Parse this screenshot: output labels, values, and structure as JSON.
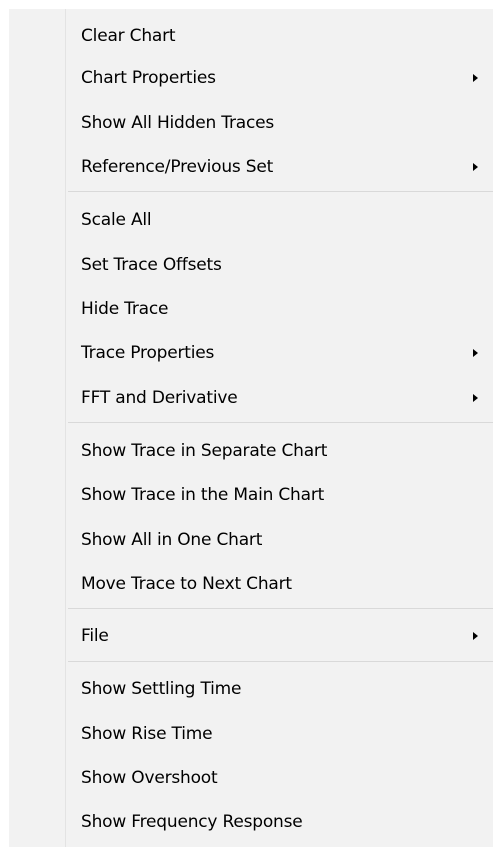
{
  "menu": {
    "items": [
      {
        "label": "Clear Chart"
      },
      {
        "label": "Chart Properties",
        "submenu": true
      },
      {
        "label": "Show All Hidden Traces"
      },
      {
        "label": "Reference/Previous Set",
        "submenu": true
      },
      {
        "label": "Scale All"
      },
      {
        "label": "Set Trace Offsets"
      },
      {
        "label": "Hide Trace"
      },
      {
        "label": "Trace Properties",
        "submenu": true
      },
      {
        "label": "FFT and Derivative",
        "submenu": true
      },
      {
        "label": "Show Trace in Separate Chart"
      },
      {
        "label": "Show Trace in the Main Chart"
      },
      {
        "label": "Show All in One Chart"
      },
      {
        "label": "Move Trace to Next Chart"
      },
      {
        "label": "File",
        "submenu": true
      },
      {
        "label": "Show Settling Time"
      },
      {
        "label": "Show Rise Time"
      },
      {
        "label": "Show Overshoot"
      },
      {
        "label": "Show Frequency Response"
      }
    ],
    "submenu_icon": "chevron-right-icon",
    "colors": {
      "background": "#f2f2f2",
      "separator": "#d9d9d9",
      "text": "#000000"
    }
  }
}
